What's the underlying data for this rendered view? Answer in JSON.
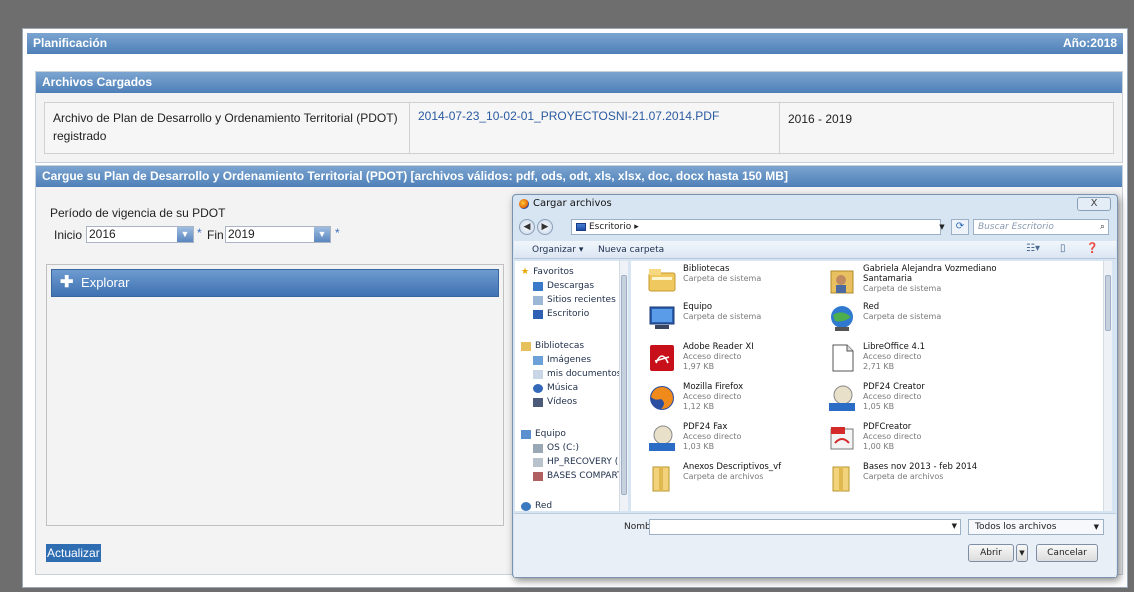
{
  "header": {
    "title": "Planificación",
    "year": "Año:2018"
  },
  "archivos": {
    "title": "Archivos Cargados",
    "row": {
      "description": "Archivo de Plan de Desarrollo y Ordenamiento Territorial (PDOT) registrado",
      "filename": "2014-07-23_10-02-01_PROYECTOSNI-21.07.2014.PDF",
      "period": "2016 - 2019"
    }
  },
  "upload": {
    "title": "Cargue su Plan de Desarrollo y Ordenamiento Territorial (PDOT) [archivos válidos: pdf, ods, odt, xls, xlsx, doc, docx hasta 150 MB]",
    "period_label": "Período de vigencia de su PDOT",
    "inicio_label": "Inicio",
    "inicio_value": "2016",
    "fin_label": "Fin",
    "fin_value": "2019",
    "required_mark": "*",
    "explorar_label": "Explorar",
    "actualizar_label": "Actualizar"
  },
  "dialog": {
    "title": "Cargar archivos",
    "close": "X",
    "address": "Escritorio",
    "address_arrow": "▸",
    "search_placeholder": "Buscar Escritorio",
    "organize": "Organizar ▾",
    "new_folder": "Nueva carpeta",
    "nav": {
      "favorites_header": "Favoritos",
      "favorites": [
        "Descargas",
        "Sitios recientes",
        "Escritorio"
      ],
      "libraries_header": "Bibliotecas",
      "libraries": [
        "Imágenes",
        "mis documentos",
        "Música",
        "Vídeos"
      ],
      "computer_header": "Equipo",
      "computer": [
        "OS (C:)",
        "HP_RECOVERY (D:",
        "BASES COMPART"
      ],
      "network_partial": "Red"
    },
    "files": [
      {
        "name": "Bibliotecas",
        "sub1": "Carpeta de sistema",
        "sub2": "",
        "icon": "library-icon"
      },
      {
        "name": "Gabriela Alejandra Vozmediano Santamaria",
        "sub1": "Carpeta de sistema",
        "sub2": "",
        "icon": "user-folder-icon"
      },
      {
        "name": "Equipo",
        "sub1": "Carpeta de sistema",
        "sub2": "",
        "icon": "computer-icon"
      },
      {
        "name": "Red",
        "sub1": "Carpeta de sistema",
        "sub2": "",
        "icon": "network-icon"
      },
      {
        "name": "Adobe Reader XI",
        "sub1": "Acceso directo",
        "sub2": "1,97 KB",
        "icon": "adobe-reader-icon"
      },
      {
        "name": "LibreOffice 4.1",
        "sub1": "Acceso directo",
        "sub2": "2,71 KB",
        "icon": "libreoffice-icon"
      },
      {
        "name": "Mozilla Firefox",
        "sub1": "Acceso directo",
        "sub2": "1,12 KB",
        "icon": "firefox-icon"
      },
      {
        "name": "PDF24 Creator",
        "sub1": "Acceso directo",
        "sub2": "1,05 KB",
        "icon": "pdf24-creator-icon"
      },
      {
        "name": "PDF24 Fax",
        "sub1": "Acceso directo",
        "sub2": "1,03 KB",
        "icon": "pdf24-fax-icon"
      },
      {
        "name": "PDFCreator",
        "sub1": "Acceso directo",
        "sub2": "1,00 KB",
        "icon": "pdfcreator-icon"
      },
      {
        "name": "Anexos Descriptivos_vf",
        "sub1": "Carpeta de archivos",
        "sub2": "",
        "icon": "folder-icon"
      },
      {
        "name": "Bases nov 2013 - feb 2014",
        "sub1": "Carpeta de archivos",
        "sub2": "",
        "icon": "folder-icon"
      }
    ],
    "filename_label": "Nombre:",
    "filetype": "Todos los archivos",
    "open_button": "Abrir",
    "cancel_button": "Cancelar"
  }
}
